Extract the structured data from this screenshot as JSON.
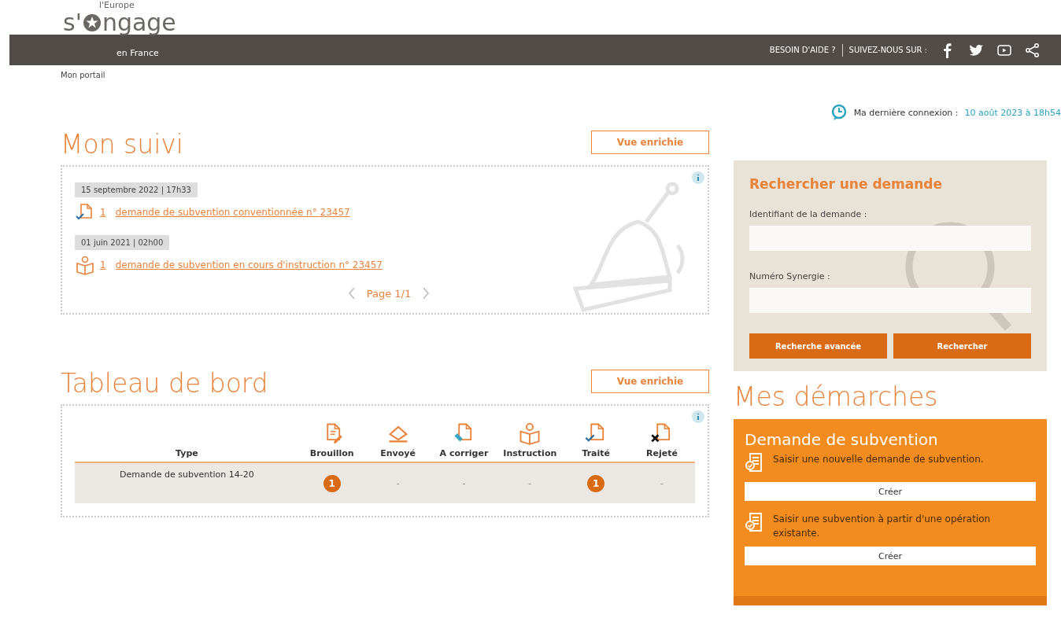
{
  "header": {
    "logo_top": "l'Europe",
    "logo_prefix": "s'",
    "logo_main": "ngage",
    "logo_sub": "en France",
    "help": "BESOIN D'AIDE ?",
    "follow": "SUIVEZ-NOUS SUR :",
    "social": [
      {
        "kind": "facebook"
      },
      {
        "kind": "twitter"
      },
      {
        "kind": "youtube"
      },
      {
        "kind": "share"
      }
    ]
  },
  "breadcrumb": "Mon portail",
  "last_login": {
    "label": "Ma dernière connexion :",
    "value": "10 août 2023 à 18h54"
  },
  "suivi": {
    "title": "Mon suivi",
    "button": "Vue enrichie",
    "entries": [
      {
        "date": "15 septembre 2022 | 17h33",
        "kind": "processed",
        "count": "1",
        "link": "demande de subvention conventionnée n° 23457"
      },
      {
        "date": "01 juin 2021 | 02h00",
        "kind": "instruction",
        "count": "1",
        "link": "demande de subvention en cours d'instruction n° 23457"
      }
    ],
    "pager": "Page 1/1"
  },
  "dashboard": {
    "title": "Tableau de bord",
    "button": "Vue enrichie",
    "columns": [
      {
        "label": "Type"
      },
      {
        "label": "Brouillon",
        "kind": "draft"
      },
      {
        "label": "Envoyé",
        "kind": "sent"
      },
      {
        "label": "A corriger",
        "kind": "correct"
      },
      {
        "label": "Instruction",
        "kind": "instruction"
      },
      {
        "label": "Traité",
        "kind": "processed"
      },
      {
        "label": "Rejeté",
        "kind": "rejected"
      }
    ],
    "rows": [
      {
        "cells": [
          {
            "kind": "type",
            "text": "Demande de subvention 14-20"
          },
          {
            "kind": "count",
            "text": "1"
          },
          {
            "kind": "empty",
            "text": "-"
          },
          {
            "kind": "empty",
            "text": "-"
          },
          {
            "kind": "empty",
            "text": "-"
          },
          {
            "kind": "count",
            "text": "1"
          },
          {
            "kind": "empty",
            "text": "-"
          }
        ]
      }
    ]
  },
  "search": {
    "title": "Rechercher une demande",
    "fields": [
      {
        "label": "Identifiant de la demande :"
      },
      {
        "label": "Numéro Synergie :"
      }
    ],
    "buttons": [
      "Recherche avancée",
      "Rechercher"
    ]
  },
  "demarches": {
    "title": "Mes démarches",
    "card_title": "Demande de subvention",
    "actions": [
      {
        "text": "Saisir une nouvelle demande de subvention.",
        "button": "Créer"
      },
      {
        "text": "Saisir une subvention à partir d'une opération existante.",
        "button": "Créer"
      }
    ]
  }
}
